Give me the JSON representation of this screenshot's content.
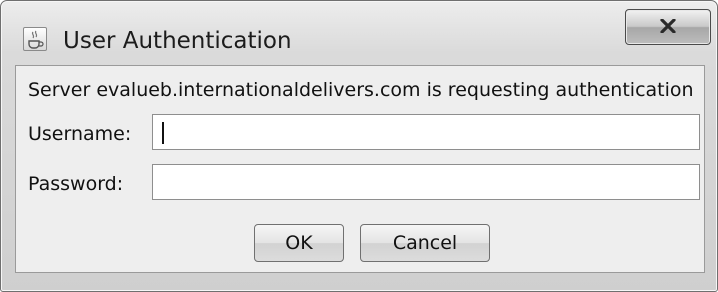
{
  "window": {
    "title": "User Authentication",
    "icon": "java-cup-icon",
    "close_icon": "close-icon"
  },
  "dialog": {
    "message": "Server evalueb.internationaldelivers.com is requesting authentication",
    "username_label": "Username:",
    "username_value": "",
    "password_label": "Password:",
    "password_value": "",
    "ok_label": "OK",
    "cancel_label": "Cancel"
  }
}
